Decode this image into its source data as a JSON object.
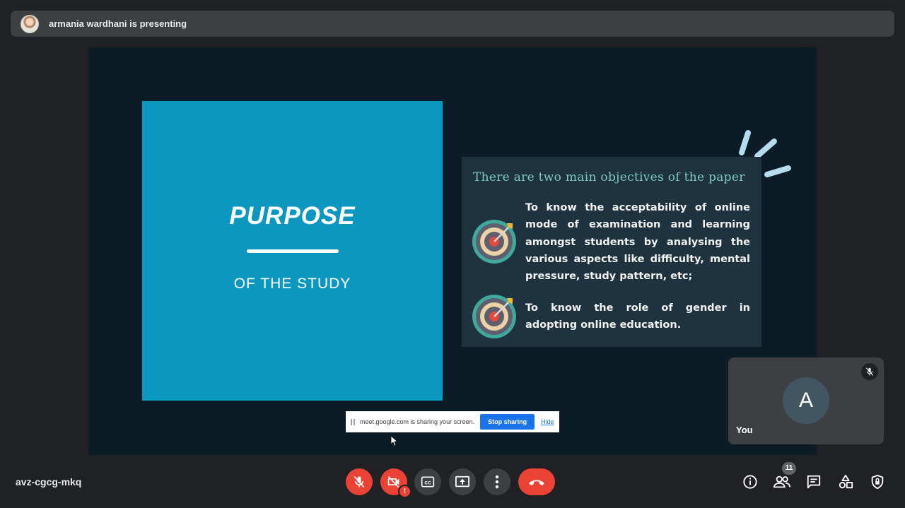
{
  "banner": {
    "presenter_text": "armania wardhani is presenting"
  },
  "slide": {
    "title": "PURPOSE",
    "subtitle": "OF THE STUDY",
    "panel_heading": "There are two main objectives of the paper",
    "objectives": [
      "To know the acceptability of online mode of examination and learning amongst students by analysing the various aspects like difficulty, mental pressure, study pattern, etc;",
      "To know the role of gender in adopting online education."
    ],
    "colors": {
      "left_bg": "#0b97c0",
      "panel_bg": "#1f323f",
      "heading": "#7ec9c2"
    }
  },
  "share_bar": {
    "message": "meet.google.com is sharing your screen.",
    "stop_label": "Stop sharing",
    "hide_label": "Hide"
  },
  "self_tile": {
    "initial": "A",
    "name": "You"
  },
  "meeting": {
    "code": "avz-cgcg-mkq",
    "participant_count": "11"
  },
  "icons": {
    "mic": "mic-off-icon",
    "camera": "camera-off-icon",
    "captions": "captions-icon",
    "present": "present-screen-icon",
    "more": "more-vert-icon",
    "end": "call-end-icon",
    "info": "info-icon",
    "people": "people-icon",
    "chat": "chat-icon",
    "activities": "activities-icon",
    "host": "host-controls-icon"
  }
}
